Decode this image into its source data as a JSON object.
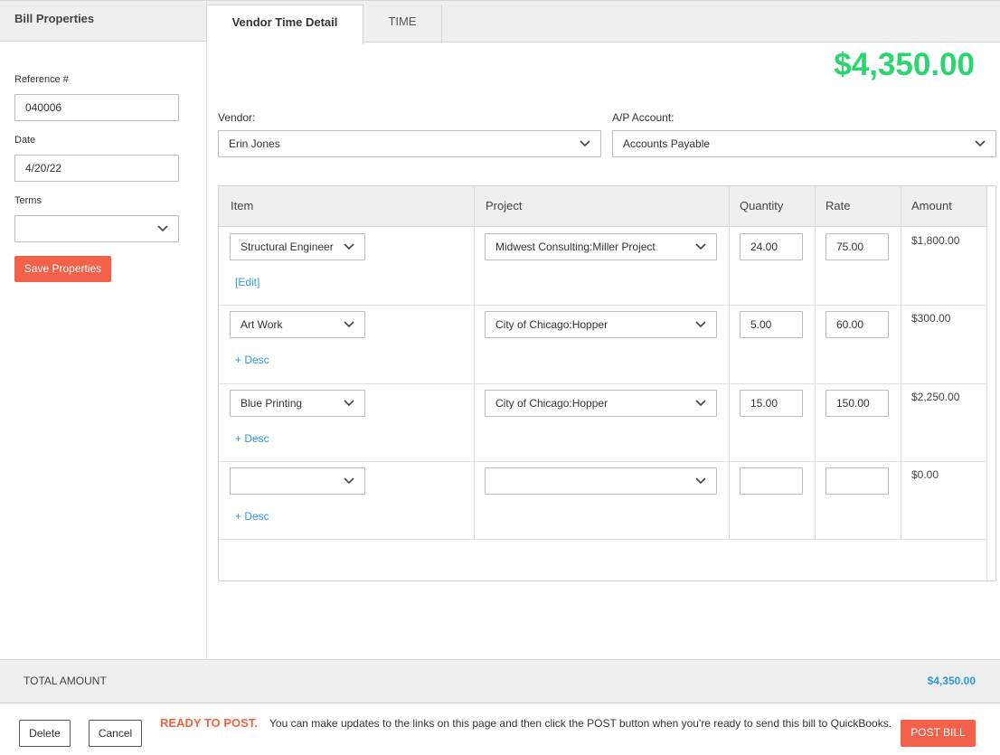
{
  "sidebar": {
    "title": "Bill Properties",
    "reference_label": "Reference #",
    "reference_value": "040006",
    "date_label": "Date",
    "date_value": "4/20/22",
    "terms_label": "Terms",
    "terms_value": "",
    "save_label": "Save Properties"
  },
  "tabs": [
    {
      "label": "Vendor Time Detail",
      "active": true
    },
    {
      "label": "TIME",
      "active": false
    }
  ],
  "header": {
    "total": "$4,350.00",
    "vendor_label": "Vendor:",
    "vendor_value": "Erin Jones",
    "ap_label": "A/P Account:",
    "ap_value": "Accounts Payable"
  },
  "table": {
    "columns": [
      "Item",
      "Project",
      "Quantity",
      "Rate",
      "Amount"
    ],
    "rows": [
      {
        "item": "Structural Engineer",
        "project": "Midwest Consulting:Miller Project",
        "quantity": "24.00",
        "rate": "75.00",
        "amount": "$1,800.00",
        "link": "[Edit]"
      },
      {
        "item": "Art Work",
        "project": "City of Chicago:Hopper",
        "quantity": "5.00",
        "rate": "60.00",
        "amount": "$300.00",
        "link": "+ Desc"
      },
      {
        "item": "Blue Printing",
        "project": "City of Chicago:Hopper",
        "quantity": "15.00",
        "rate": "150.00",
        "amount": "$2,250.00",
        "link": "+ Desc"
      },
      {
        "item": "",
        "project": "",
        "quantity": "",
        "rate": "",
        "amount": "$0.00",
        "link": "+ Desc"
      }
    ]
  },
  "footer": {
    "total_label": "TOTAL AMOUNT",
    "total_value": "$4,350.00",
    "delete_label": "Delete",
    "cancel_label": "Cancel",
    "ready_title": "READY TO POST.",
    "ready_message": "You can make updates to the links on this page and then click the POST button when you're ready to send this bill to QuickBooks.",
    "post_label": "POST BILL"
  },
  "colors": {
    "accent": "#f4614a",
    "total_green": "#2bd66f",
    "link_blue": "#2b9bd6"
  }
}
